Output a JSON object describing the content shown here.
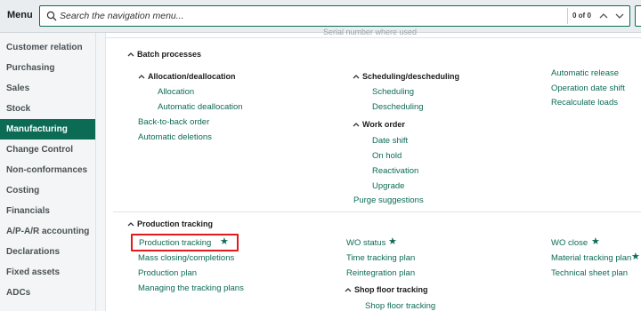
{
  "topbar": {
    "menu_label": "Menu",
    "search_placeholder": "Search the navigation menu...",
    "match_count": "0 of 0"
  },
  "sidebar": {
    "items": [
      {
        "label": "Customer relation",
        "active": false
      },
      {
        "label": "Purchasing",
        "active": false
      },
      {
        "label": "Sales",
        "active": false
      },
      {
        "label": "Stock",
        "active": false
      },
      {
        "label": "Manufacturing",
        "active": true
      },
      {
        "label": "Change Control",
        "active": false
      },
      {
        "label": "Non-conformances",
        "active": false
      },
      {
        "label": "Costing",
        "active": false
      },
      {
        "label": "Financials",
        "active": false
      },
      {
        "label": "A/P-A/R accounting",
        "active": false
      },
      {
        "label": "Declarations",
        "active": false
      },
      {
        "label": "Fixed assets",
        "active": false
      },
      {
        "label": "ADCs",
        "active": false
      }
    ]
  },
  "main": {
    "cut_text": "Serial number where used",
    "batch": {
      "title": "Batch processes",
      "allocation": {
        "title": "Allocation/deallocation",
        "links": [
          "Allocation",
          "Automatic deallocation"
        ]
      },
      "col1_links": [
        "Back-to-back order",
        "Automatic deletions"
      ],
      "scheduling": {
        "title": "Scheduling/descheduling",
        "links": [
          "Scheduling",
          "Descheduling"
        ]
      },
      "work_order": {
        "title": "Work order",
        "links": [
          "Date shift",
          "On hold",
          "Reactivation",
          "Upgrade"
        ]
      },
      "purge": "Purge suggestions",
      "col3_links": [
        "Automatic release",
        "Operation date shift",
        "Recalculate loads"
      ]
    },
    "production": {
      "title": "Production tracking",
      "col1_links": [
        "Production tracking",
        "Mass closing/completions",
        "Production plan",
        "Managing the tracking plans"
      ],
      "col2_links": [
        "WO status",
        "Time tracking plan",
        "Reintegration plan"
      ],
      "shop_floor": {
        "title": "Shop floor tracking",
        "links": [
          "Shop floor tracking"
        ]
      },
      "col3_links": [
        "WO close",
        "Material tracking plan",
        "Technical sheet plan"
      ]
    },
    "favorites": [
      "Production tracking",
      "WO status",
      "WO close",
      "Material tracking plan"
    ]
  },
  "colors": {
    "accent": "#0c6b55",
    "highlight": "#e11a1a",
    "sidebar_bg": "#f3f5f6"
  }
}
